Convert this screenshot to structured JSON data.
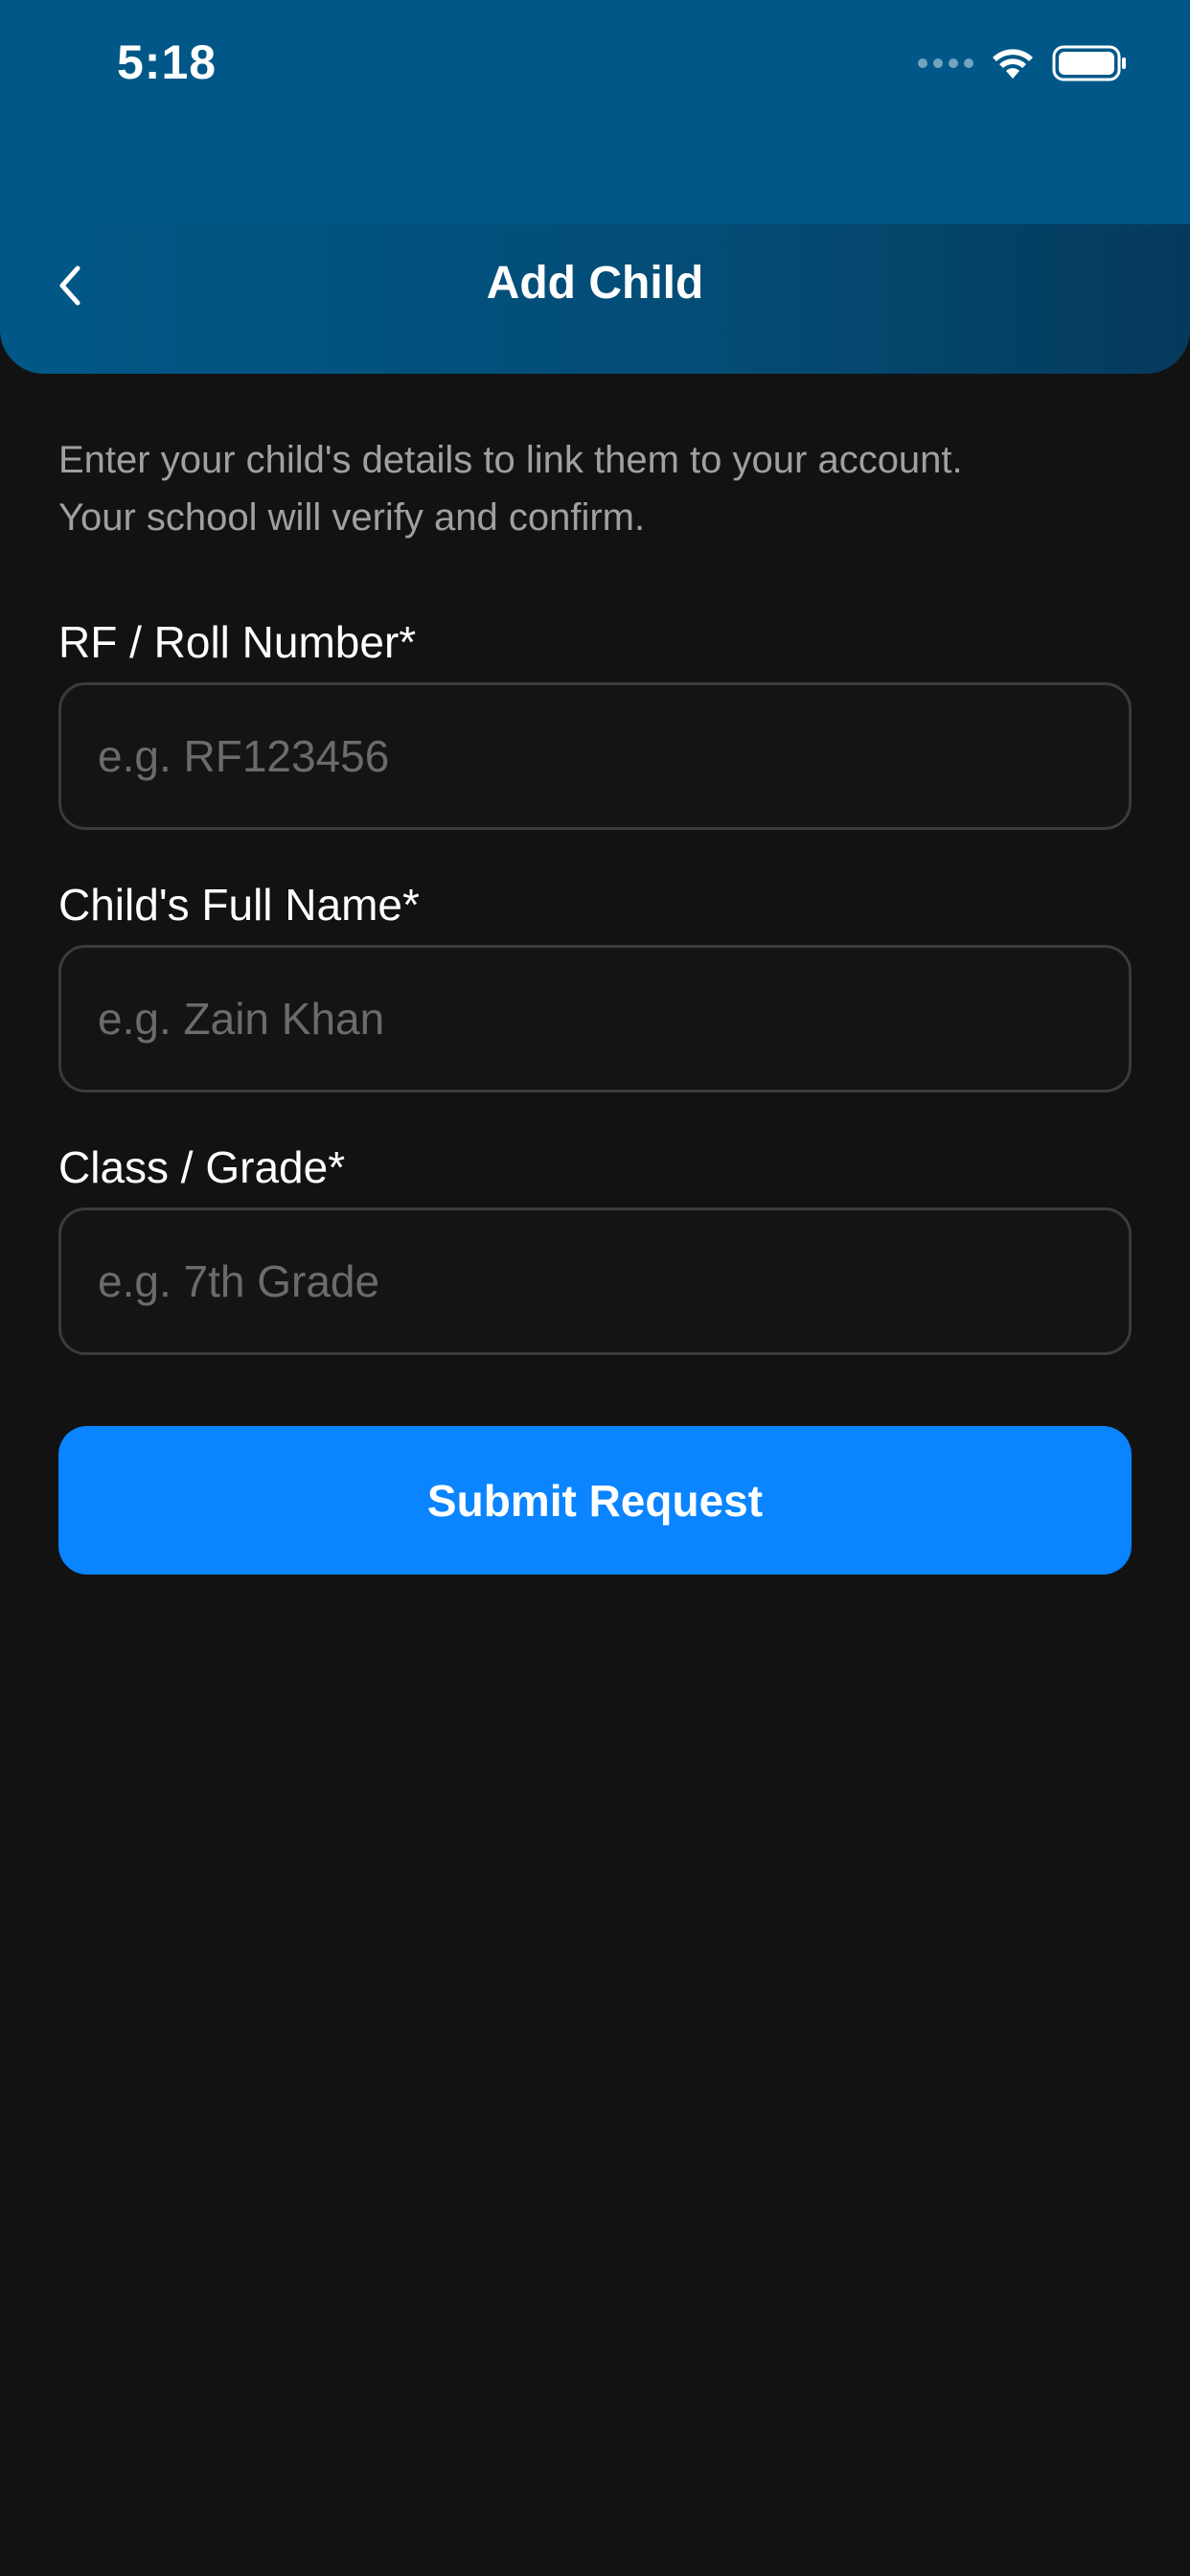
{
  "status_bar": {
    "time": "5:18"
  },
  "nav": {
    "title": "Add Child",
    "back_icon": "chevron-left-icon"
  },
  "intro": {
    "line1": "Enter your child's details to link them to your account.",
    "line2": "Your school will verify and confirm."
  },
  "form": {
    "fields": [
      {
        "label": "RF / Roll Number*",
        "placeholder": "e.g. RF123456",
        "value": ""
      },
      {
        "label": "Child's Full Name*",
        "placeholder": "e.g. Zain Khan",
        "value": ""
      },
      {
        "label": "Class / Grade*",
        "placeholder": "e.g. 7th Grade",
        "value": ""
      }
    ],
    "submit_label": "Submit Request"
  },
  "colors": {
    "background": "#121212",
    "header": "#015888",
    "accent": "#0a84ff",
    "input_border": "#3b3b3b",
    "placeholder": "#6b6b6b",
    "muted_text": "#a0a0a0"
  }
}
